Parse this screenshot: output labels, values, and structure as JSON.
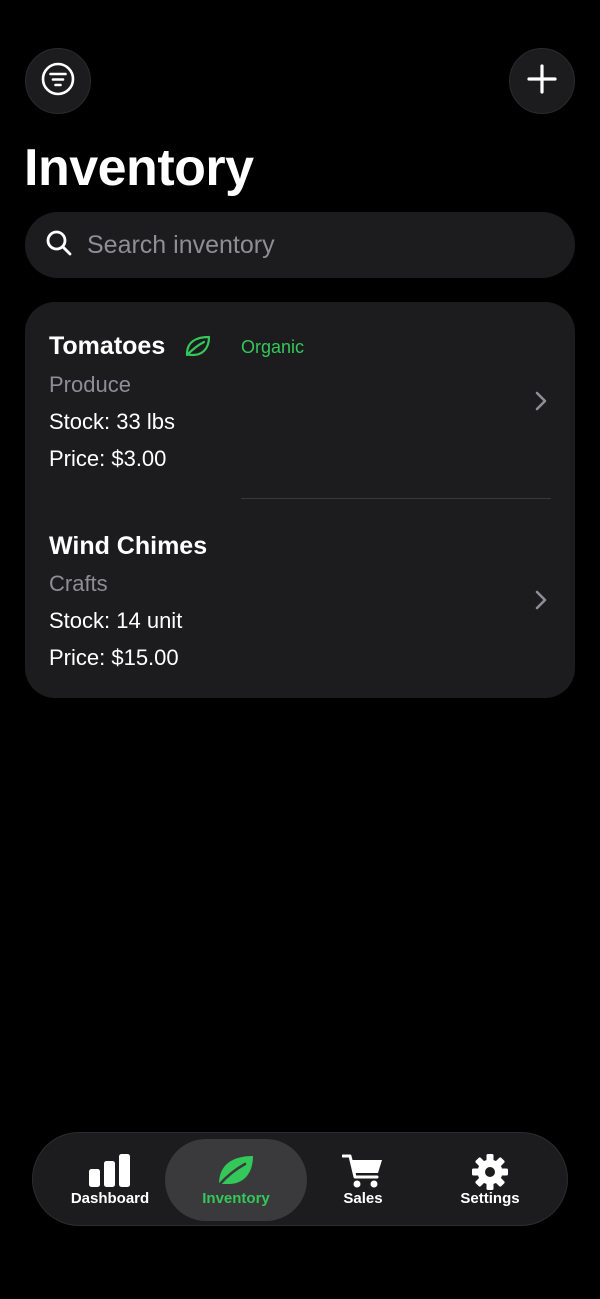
{
  "header": {
    "title": "Inventory"
  },
  "search": {
    "placeholder": "Search inventory",
    "value": ""
  },
  "items": [
    {
      "name": "Tomatoes",
      "category": "Produce",
      "stock": "Stock: 33 lbs",
      "price": "Price: $3.00",
      "badge": "Organic",
      "badge_icon": "leaf-icon"
    },
    {
      "name": "Wind Chimes",
      "category": "Crafts",
      "stock": "Stock: 14 unit",
      "price": "Price: $15.00"
    }
  ],
  "tabs": [
    {
      "label": "Dashboard",
      "icon": "bar-chart-icon",
      "active": false
    },
    {
      "label": "Inventory",
      "icon": "leaf-icon",
      "active": true
    },
    {
      "label": "Sales",
      "icon": "cart-icon",
      "active": false
    },
    {
      "label": "Settings",
      "icon": "gear-icon",
      "active": false
    }
  ],
  "colors": {
    "background": "#000000",
    "surface": "#1c1c1e",
    "accent": "#34c759",
    "secondary_text": "#8e8e93"
  }
}
